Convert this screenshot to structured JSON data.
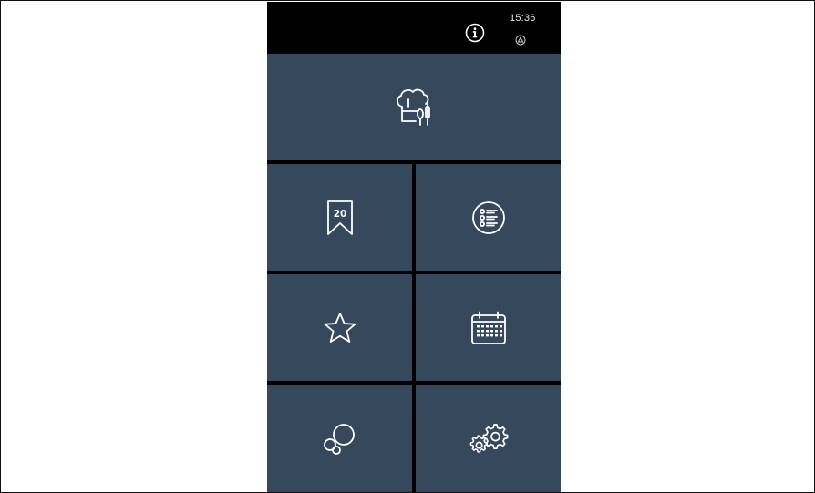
{
  "status_bar": {
    "time": "15:36",
    "info_icon": "info-icon",
    "status_icon": "triangle-in-circle-icon"
  },
  "menu": {
    "top_tile": {
      "icon": "chef-hat-utensils-icon"
    },
    "tiles": [
      {
        "icon": "bookmark-20-icon",
        "badge": "20"
      },
      {
        "icon": "list-icon"
      },
      {
        "icon": "star-icon"
      },
      {
        "icon": "calendar-icon"
      },
      {
        "icon": "bubbles-icon"
      },
      {
        "icon": "gears-icon"
      }
    ]
  },
  "colors": {
    "tile": "#36495c",
    "background": "#000000",
    "icon": "#ffffff"
  }
}
